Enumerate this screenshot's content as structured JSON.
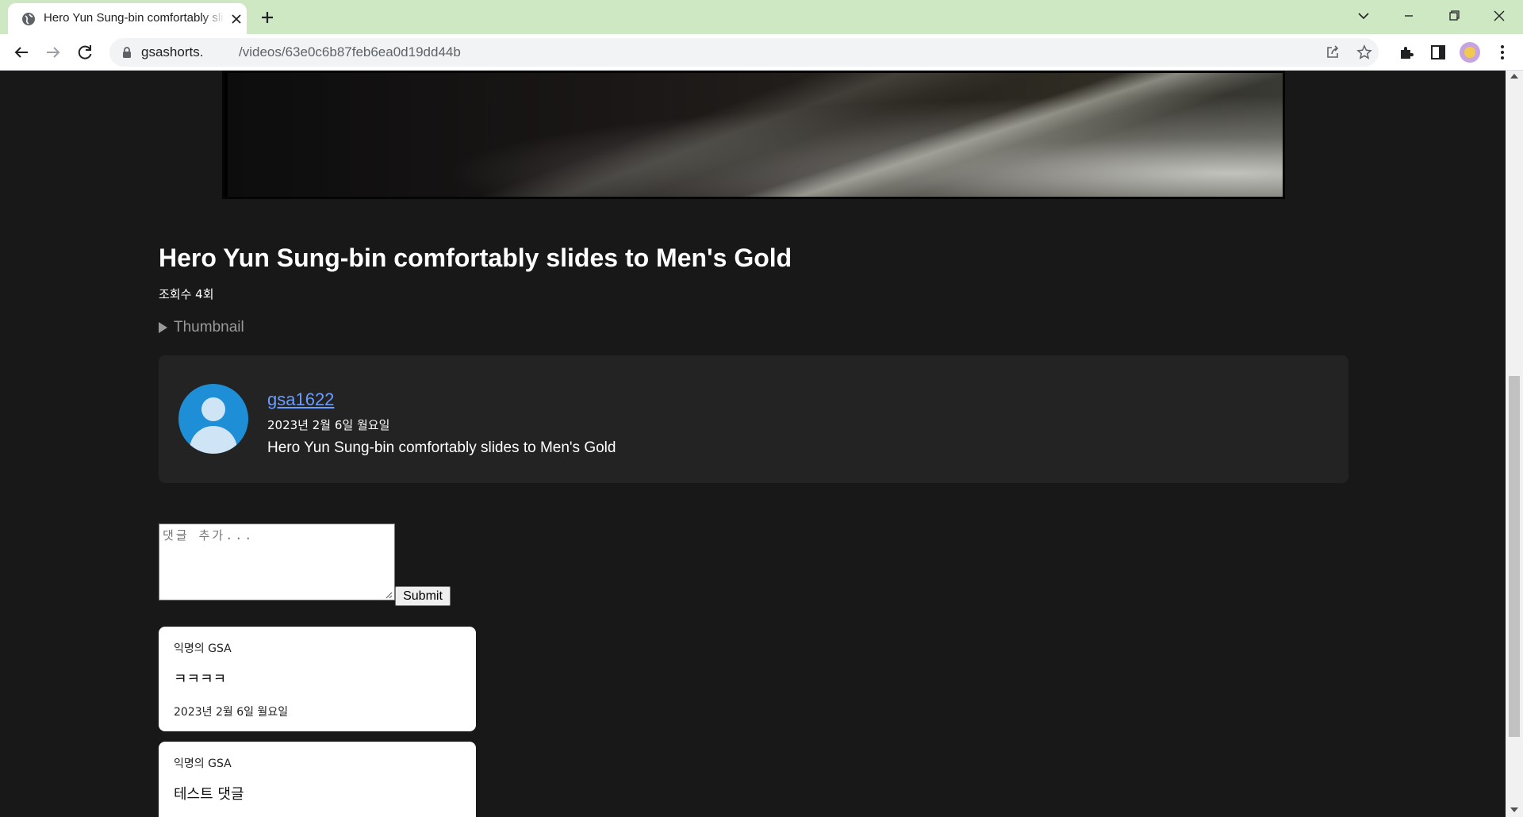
{
  "browser": {
    "tab_title": "Hero Yun Sung-bin comfortably slides to Men's Gold",
    "url_host": "gsashorts.",
    "url_path": "/videos/63e0c6b87feb6ea0d19dd44b"
  },
  "video": {
    "title": "Hero Yun Sung-bin comfortably slides to Men's Gold",
    "view_count": "조회수 4회",
    "thumbnail_toggle": "Thumbnail"
  },
  "uploader": {
    "name": "gsa1622",
    "date": "2023년 2월 6일 월요일",
    "description": "Hero Yun Sung-bin comfortably slides to Men's Gold"
  },
  "comment_form": {
    "placeholder": "댓글 추가...",
    "submit_label": "Submit"
  },
  "comments": [
    {
      "author": "익명의 GSA",
      "text": "ㅋㅋㅋㅋ",
      "date": "2023년 2월 6일 월요일"
    },
    {
      "author": "익명의 GSA",
      "text": "테스트 댓글"
    }
  ]
}
